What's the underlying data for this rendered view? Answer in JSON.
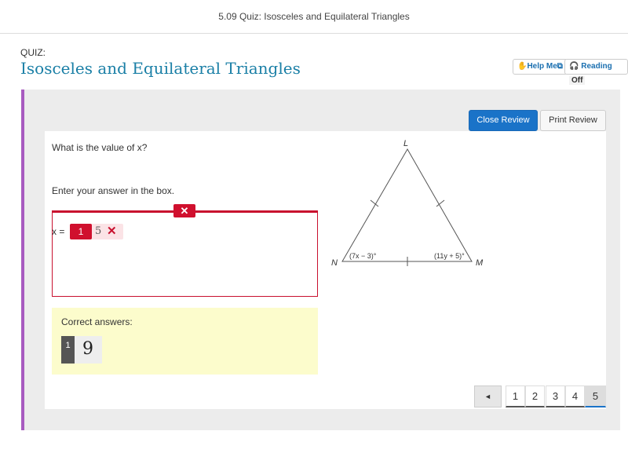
{
  "header": {
    "window_title": "5.09 Quiz: Isosceles and Equilateral Triangles",
    "quiz_label": "QUIZ:",
    "title": "Isosceles and Equilateral Triangles",
    "help_me": "Help Me",
    "reading": "Reading",
    "reading_state": "Off"
  },
  "review": {
    "close": "Close Review",
    "print": "Print Review"
  },
  "question": {
    "prompt": "What is the value of x?",
    "instruction": "Enter your answer in the box.",
    "var_label": "x =",
    "response_index": "1",
    "response_value": "5",
    "response_status": "incorrect",
    "correct_label": "Correct answers:",
    "correct_index": "1",
    "correct_value": "9"
  },
  "figure": {
    "vertices": [
      "L",
      "N",
      "M"
    ],
    "angle_N": "(7x − 3)°",
    "angle_M": "(11y + 5)°"
  },
  "pagination": {
    "prev": "◄",
    "pages": [
      "1",
      "2",
      "3",
      "4",
      "5"
    ],
    "current": "5"
  },
  "colors": {
    "accent": "#1a73c8",
    "error": "#d0102e",
    "title": "#1a7fa6",
    "sidebar": "#a85bc0",
    "correct_bg": "#fcfccc"
  }
}
